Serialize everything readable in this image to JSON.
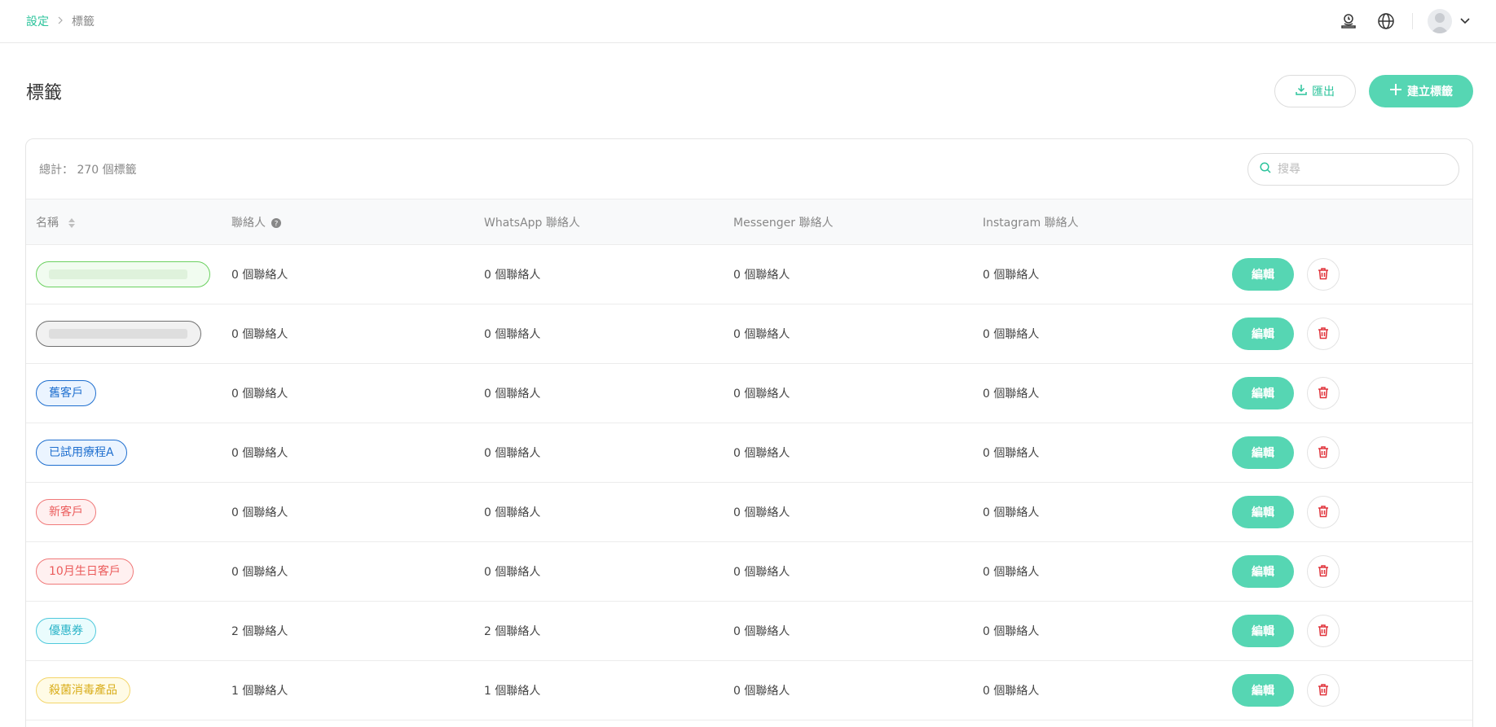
{
  "breadcrumb": {
    "parent": "設定",
    "current": "標籤"
  },
  "topbar": {
    "icons": [
      "support-icon",
      "globe-icon",
      "avatar",
      "chevron-down-icon"
    ]
  },
  "page": {
    "title": "標籤",
    "export_label": "匯出",
    "create_label": "建立標籤"
  },
  "summary": {
    "total_text": "總計： 270 個標籤"
  },
  "search": {
    "placeholder": "搜尋"
  },
  "table": {
    "headers": {
      "name": "名稱",
      "contacts": "聯絡人",
      "whatsapp": "WhatsApp 聯絡人",
      "messenger": "Messenger 聯絡人",
      "instagram": "Instagram 聯絡人"
    },
    "rows": [
      {
        "tag": "",
        "style": "green-blur",
        "contacts": "0 個聯絡人",
        "whatsapp": "0 個聯絡人",
        "messenger": "0 個聯絡人",
        "instagram": "0 個聯絡人"
      },
      {
        "tag": "",
        "style": "gray-blur",
        "contacts": "0 個聯絡人",
        "whatsapp": "0 個聯絡人",
        "messenger": "0 個聯絡人",
        "instagram": "0 個聯絡人"
      },
      {
        "tag": "舊客戶",
        "style": "blue",
        "contacts": "0 個聯絡人",
        "whatsapp": "0 個聯絡人",
        "messenger": "0 個聯絡人",
        "instagram": "0 個聯絡人"
      },
      {
        "tag": "已試用療程A",
        "style": "blue",
        "contacts": "0 個聯絡人",
        "whatsapp": "0 個聯絡人",
        "messenger": "0 個聯絡人",
        "instagram": "0 個聯絡人"
      },
      {
        "tag": "新客戶",
        "style": "red",
        "contacts": "0 個聯絡人",
        "whatsapp": "0 個聯絡人",
        "messenger": "0 個聯絡人",
        "instagram": "0 個聯絡人"
      },
      {
        "tag": "10月生日客戶",
        "style": "red",
        "contacts": "0 個聯絡人",
        "whatsapp": "0 個聯絡人",
        "messenger": "0 個聯絡人",
        "instagram": "0 個聯絡人"
      },
      {
        "tag": "優惠券",
        "style": "cyan",
        "contacts": "2 個聯絡人",
        "whatsapp": "2 個聯絡人",
        "messenger": "0 個聯絡人",
        "instagram": "0 個聯絡人"
      },
      {
        "tag": "殺菌消毒產品",
        "style": "yellow",
        "contacts": "1 個聯絡人",
        "whatsapp": "1 個聯絡人",
        "messenger": "0 個聯絡人",
        "instagram": "0 個聯絡人"
      }
    ],
    "edit_label": "編輯"
  },
  "colors": {
    "accent": "#56d6b3",
    "accent_text": "#2bc39b",
    "danger": "#e0323a"
  }
}
